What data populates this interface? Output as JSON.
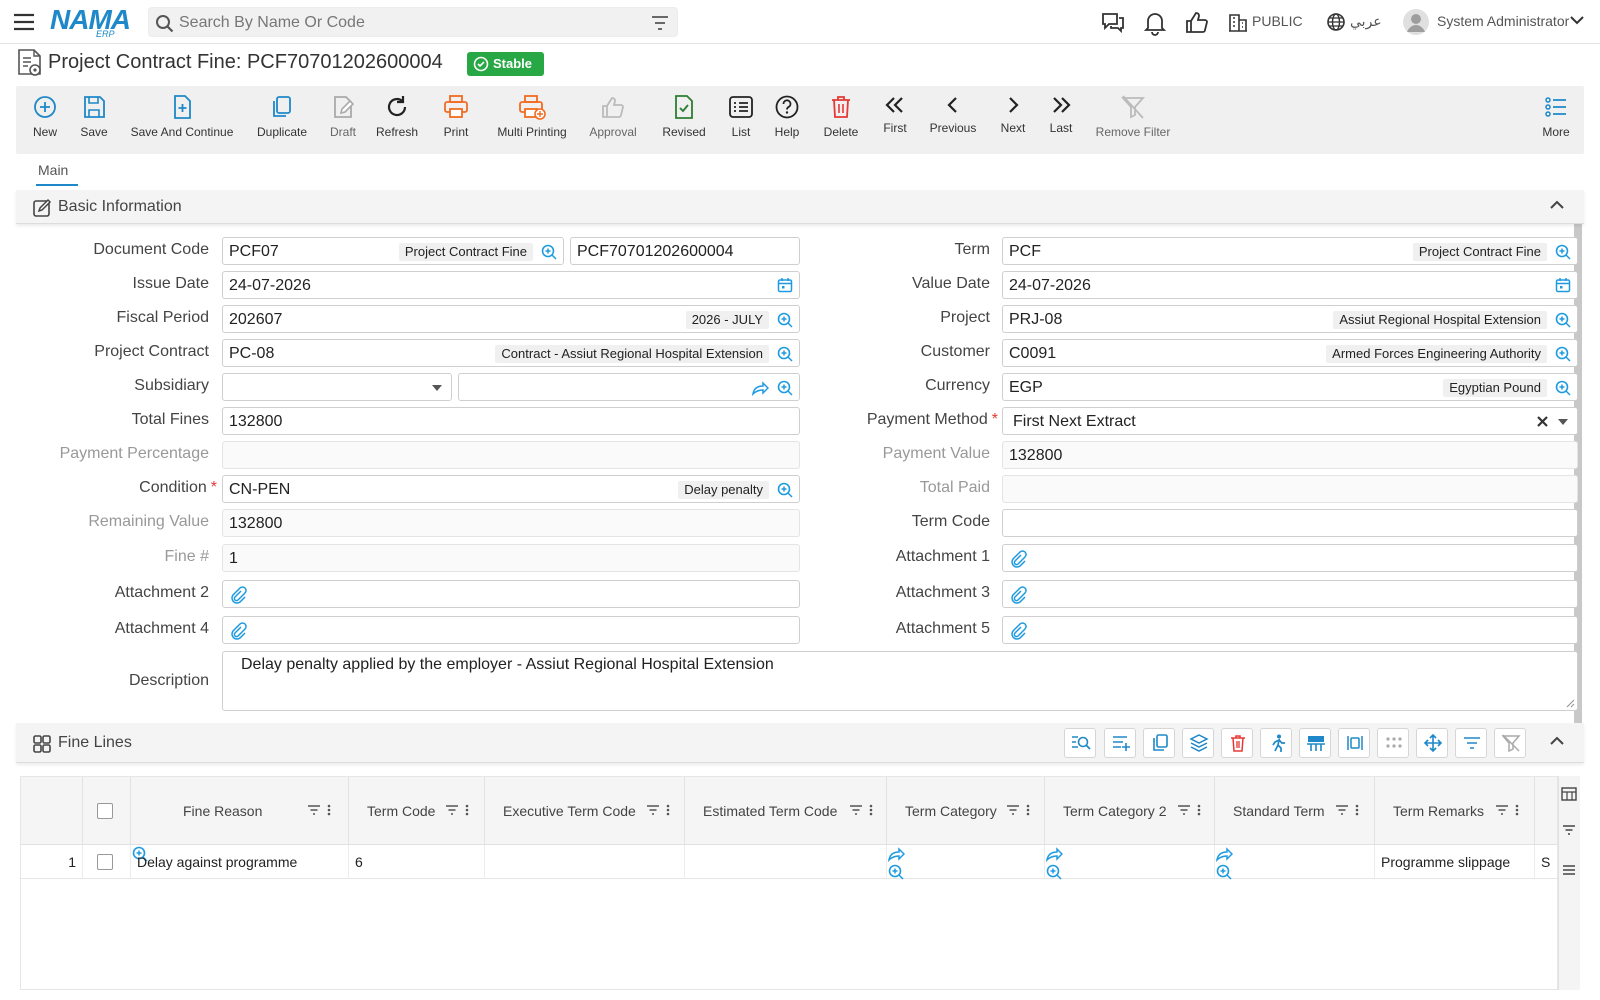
{
  "topbar": {
    "logo_text": "NAMA",
    "logo_sub": "ERP",
    "search_placeholder": "Search By Name Or Code",
    "public_label": "PUBLIC",
    "language_label": "عربي",
    "user_name": "System Administrator"
  },
  "page": {
    "title": "Project Contract Fine: PCF70701202600004",
    "status": "Stable"
  },
  "toolbar": {
    "new": "New",
    "save": "Save",
    "save_continue": "Save And Continue",
    "duplicate": "Duplicate",
    "draft": "Draft",
    "refresh": "Refresh",
    "print": "Print",
    "multi_printing": "Multi Printing",
    "approval": "Approval",
    "revised": "Revised",
    "list": "List",
    "help": "Help",
    "delete": "Delete",
    "first": "First",
    "previous": "Previous",
    "next": "Next",
    "last": "Last",
    "remove_filter": "Remove Filter",
    "more": "More"
  },
  "tabs": {
    "main": "Main"
  },
  "basic": {
    "title": "Basic Information",
    "document_code": {
      "label": "Document Code",
      "code": "PCF07",
      "name": "Project Contract Fine",
      "number": "PCF70701202600004"
    },
    "term": {
      "label": "Term",
      "code": "PCF",
      "name": "Project Contract Fine"
    },
    "issue_date": {
      "label": "Issue Date",
      "value": "24-07-2026"
    },
    "value_date": {
      "label": "Value Date",
      "value": "24-07-2026"
    },
    "fiscal_period": {
      "label": "Fiscal Period",
      "code": "202607",
      "name": "2026 - JULY"
    },
    "project": {
      "label": "Project",
      "code": "PRJ-08",
      "name": "Assiut Regional Hospital Extension"
    },
    "project_contract": {
      "label": "Project Contract",
      "code": "PC-08",
      "name": "Contract - Assiut Regional Hospital Extension"
    },
    "customer": {
      "label": "Customer",
      "code": "C0091",
      "name": "Armed Forces Engineering Authority"
    },
    "subsidiary": {
      "label": "Subsidiary",
      "value": ""
    },
    "currency": {
      "label": "Currency",
      "code": "EGP",
      "name": "Egyptian Pound"
    },
    "total_fines": {
      "label": "Total Fines",
      "value": "132800"
    },
    "payment_method": {
      "label": "Payment Method",
      "value": "First Next Extract"
    },
    "payment_percentage": {
      "label": "Payment Percentage",
      "value": ""
    },
    "payment_value": {
      "label": "Payment Value",
      "value": "132800"
    },
    "condition": {
      "label": "Condition",
      "code": "CN-PEN",
      "name": "Delay penalty"
    },
    "total_paid": {
      "label": "Total Paid",
      "value": ""
    },
    "remaining_value": {
      "label": "Remaining Value",
      "value": "132800"
    },
    "term_code": {
      "label": "Term Code",
      "value": ""
    },
    "fine_no": {
      "label": "Fine #",
      "value": "1"
    },
    "attachment1": {
      "label": "Attachment 1"
    },
    "attachment2": {
      "label": "Attachment 2"
    },
    "attachment3": {
      "label": "Attachment 3"
    },
    "attachment4": {
      "label": "Attachment 4"
    },
    "attachment5": {
      "label": "Attachment 5"
    },
    "description": {
      "label": "Description",
      "value": "Delay penalty applied by the employer - Assiut Regional Hospital Extension"
    }
  },
  "fine_lines": {
    "title": "Fine Lines",
    "columns": [
      "Fine Reason",
      "Term Code",
      "Executive Term Code",
      "Estimated Term Code",
      "Term Category",
      "Term Category 2",
      "Standard Term",
      "Term Remarks"
    ],
    "rows": [
      {
        "no": "1",
        "fine_reason": "Delay against programme",
        "term_code": "6",
        "executive_term_code": "",
        "estimated_term_code": "",
        "term_category": "",
        "term_category_2": "",
        "standard_term": "",
        "term_remarks": "Programme slippage",
        "overflow": "S"
      }
    ]
  }
}
